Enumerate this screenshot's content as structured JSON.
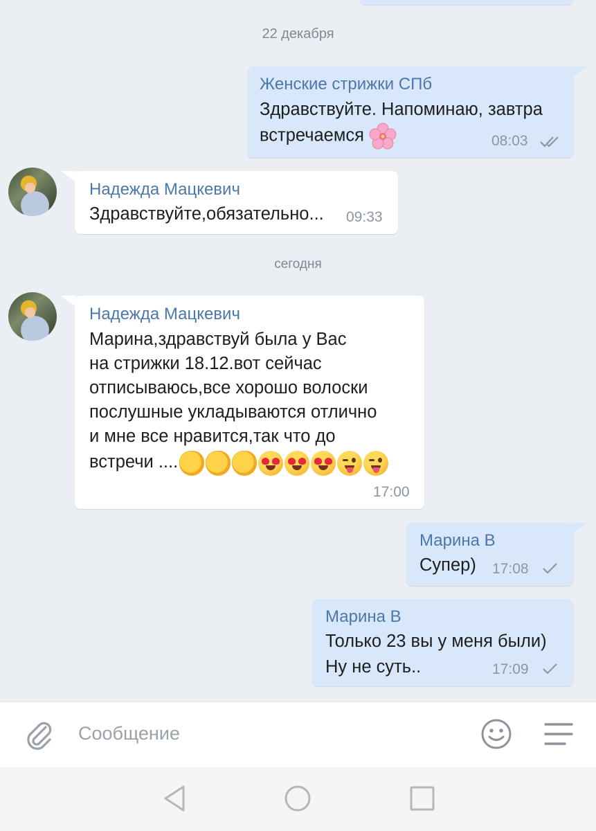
{
  "dates": {
    "first": "22 декабря",
    "second": "сегодня"
  },
  "messages": [
    {
      "direction": "outgoing",
      "sender": "Женские стрижки СПб",
      "lines": [
        "Здравствуйте. Напоминаю, завтра",
        "встречаемся"
      ],
      "emoji": "🌸",
      "time": "08:03",
      "status": "read"
    },
    {
      "direction": "incoming",
      "sender": "Надежда Мацкевич",
      "lines": [
        "Здравствуйте,обязательно..."
      ],
      "time": "09:33"
    },
    {
      "direction": "incoming",
      "sender": "Надежда Мацкевич",
      "lines": [
        "Марина,здравствуй была у Вас",
        "на стрижки 18.12.вот сейчас",
        "отписываюсь,все хорошо волоски",
        "послушные укладываются отлично",
        "и мне все нравится,так что до",
        "встречи ...."
      ],
      "emoji": "👏👏👏😍😍😍😜😜",
      "time": "17:00"
    },
    {
      "direction": "outgoing",
      "sender": "Марина В",
      "lines": [
        "Супер)"
      ],
      "time": "17:08",
      "status": "sent"
    },
    {
      "direction": "outgoing",
      "sender": "Марина В",
      "lines": [
        "Только 23 вы у меня были)",
        "Ну не суть.."
      ],
      "time": "17:09",
      "status": "sent"
    }
  ],
  "composer": {
    "placeholder": "Сообщение",
    "attach_icon": "paperclip-icon",
    "emoji_icon": "smiley-icon",
    "menu_icon": "menu-lines-icon"
  },
  "navbar": {
    "back_icon": "back-triangle-icon",
    "home_icon": "home-circle-icon",
    "recents_icon": "recents-square-icon"
  },
  "colors": {
    "background": "#ebeff4",
    "outgoing_bubble": "#d9e7fa",
    "incoming_bubble": "#ffffff",
    "sender_name": "#4b78a8"
  }
}
